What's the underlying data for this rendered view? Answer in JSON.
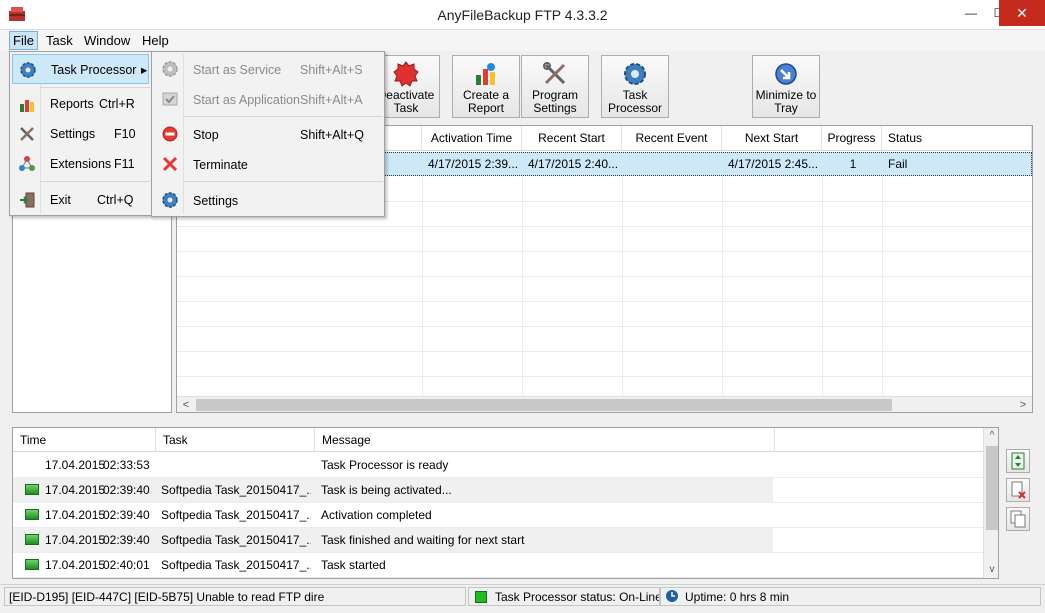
{
  "window": {
    "title": "AnyFileBackup FTP 4.3.3.2",
    "minimize": "—",
    "maximize": "☐",
    "close": "✕"
  },
  "menubar": {
    "file": "File",
    "task": "Task",
    "window": "Window",
    "help": "Help"
  },
  "file_menu": {
    "items": [
      {
        "label": "Task Processor",
        "shortcut": "",
        "icon": "gear-icon",
        "has_submenu": true
      },
      {
        "label": "Reports",
        "shortcut": "Ctrl+R",
        "icon": "chart-icon"
      },
      {
        "label": "Settings",
        "shortcut": "F10",
        "icon": "tools-icon"
      },
      {
        "label": "Extensions",
        "shortcut": "F11",
        "icon": "extensions-icon"
      },
      {
        "label": "Exit",
        "shortcut": "Ctrl+Q",
        "icon": "exit-icon"
      }
    ],
    "submenu_arrow": "▸"
  },
  "task_processor_menu": {
    "items": [
      {
        "label": "Start as Service",
        "shortcut": "Shift+Alt+S",
        "icon": "service-gear-icon",
        "enabled": false
      },
      {
        "label": "Start as Application",
        "shortcut": "Shift+Alt+A",
        "icon": "app-check-icon",
        "enabled": false
      },
      {
        "label": "Stop",
        "shortcut": "Shift+Alt+Q",
        "icon": "stop-icon",
        "enabled": true
      },
      {
        "label": "Terminate",
        "shortcut": "",
        "icon": "terminate-icon",
        "enabled": true
      },
      {
        "label": "Settings",
        "shortcut": "",
        "icon": "settings-gear-icon",
        "enabled": true
      }
    ]
  },
  "toolbar": {
    "buttons": [
      {
        "label_line1": "Deactivate",
        "label_line2": "Task",
        "icon": "deactivate-icon"
      },
      {
        "label_line1": "Create a",
        "label_line2": "Report",
        "icon": "report-icon"
      },
      {
        "label_line1": "Program",
        "label_line2": "Settings",
        "icon": "program-settings-icon"
      },
      {
        "label_line1": "Task",
        "label_line2": "Processor",
        "icon": "task-processor-icon"
      },
      {
        "label_line1": "Minimize to",
        "label_line2": "Tray",
        "icon": "minimize-tray-icon"
      }
    ]
  },
  "task_grid": {
    "columns": [
      "Activation Time",
      "Recent Start",
      "Recent Event",
      "Next Start",
      "Progress",
      "Status"
    ],
    "rows": [
      {
        "activation_time": "4/17/2015 2:39...",
        "recent_start": "4/17/2015 2:40...",
        "recent_event": "",
        "next_start": "4/17/2015 2:45...",
        "progress": "1",
        "status": "Fail"
      }
    ],
    "scroll_left": "<",
    "scroll_right": ">"
  },
  "log": {
    "columns": [
      "Time",
      "Task",
      "Message"
    ],
    "rows": [
      {
        "date": "17.04.2015",
        "time": "02:33:53",
        "task": "",
        "message": "Task Processor is ready",
        "has_led": false
      },
      {
        "date": "17.04.2015",
        "time": "02:39:40",
        "task": "Softpedia Task_20150417_...",
        "message": "Task is being activated...",
        "has_led": true
      },
      {
        "date": "17.04.2015",
        "time": "02:39:40",
        "task": "Softpedia Task_20150417_...",
        "message": "Activation completed",
        "has_led": true
      },
      {
        "date": "17.04.2015",
        "time": "02:39:40",
        "task": "Softpedia Task_20150417_...",
        "message": "Task finished and waiting for next start",
        "has_led": true
      },
      {
        "date": "17.04.2015",
        "time": "02:40:01",
        "task": "Softpedia Task_20150417_...",
        "message": "Task started",
        "has_led": true
      }
    ],
    "scroll_up": "^",
    "scroll_down": "v"
  },
  "side_buttons": [
    "expand-log-icon",
    "clear-log-icon",
    "copy-log-icon"
  ],
  "statusbar": {
    "message": "[EID-D195] [EID-447C] [EID-5B75] Unable to read FTP dire",
    "processor_label": "Task Processor status:",
    "processor_status": "On-Line",
    "uptime_label": "Uptime:",
    "uptime_value": "0 hrs 8 min"
  },
  "colors": {
    "selection": "#cde8f7",
    "close_button": "#c42b1c",
    "online_led": "#22bb22"
  }
}
